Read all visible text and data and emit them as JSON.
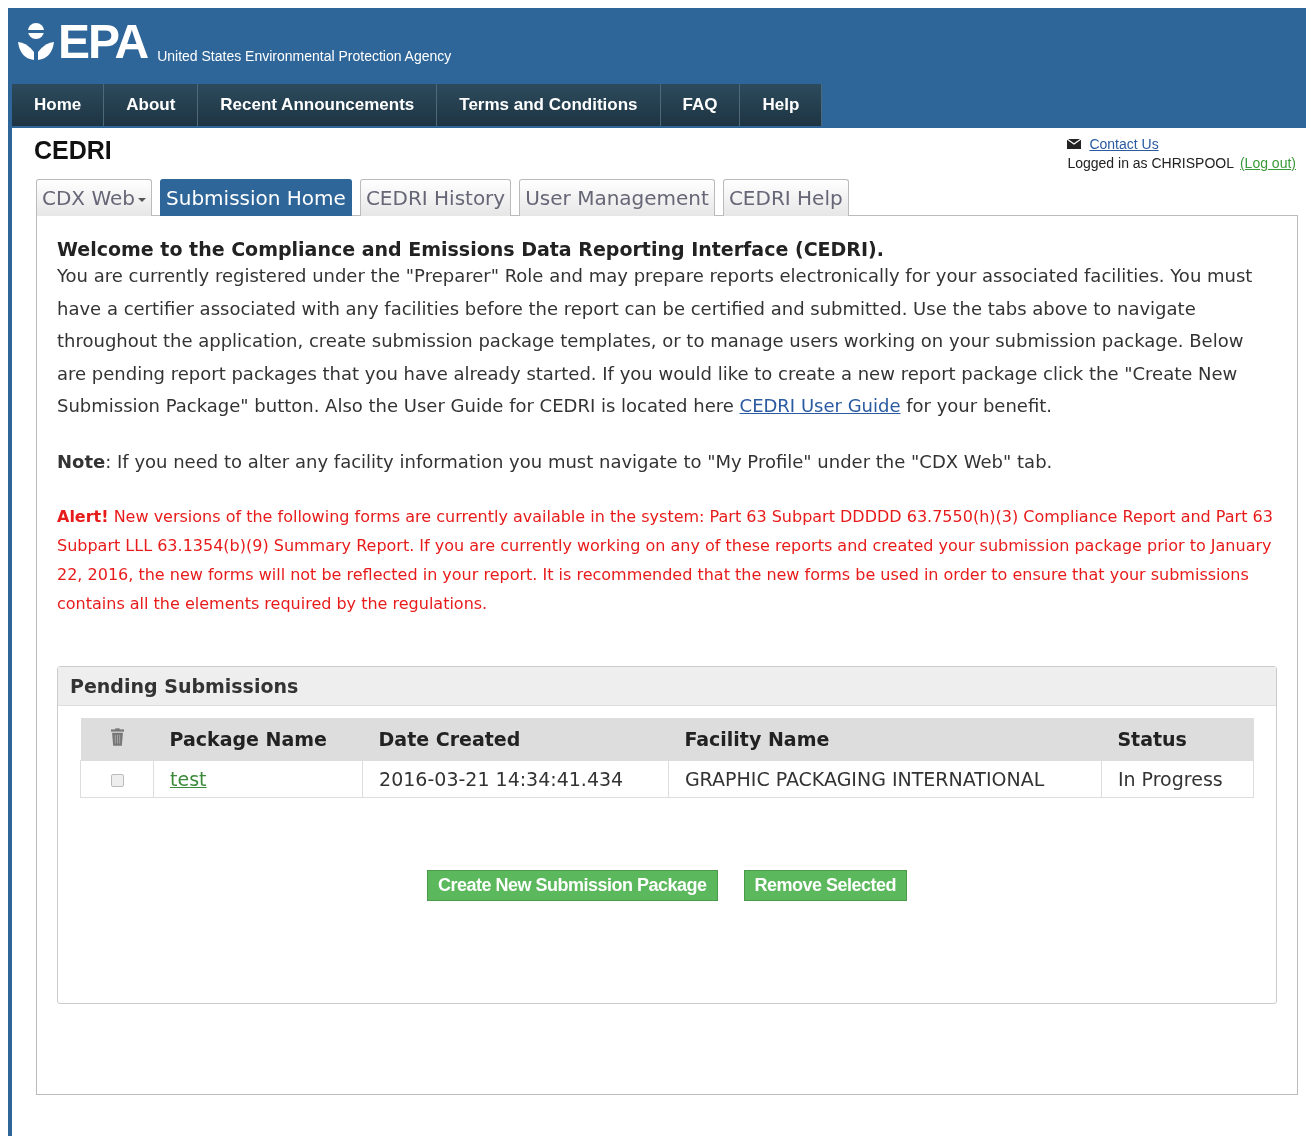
{
  "header": {
    "logo_text": "EPA",
    "agency": "United States Environmental Protection Agency"
  },
  "nav": [
    {
      "label": "Home"
    },
    {
      "label": "About"
    },
    {
      "label": "Recent Announcements"
    },
    {
      "label": "Terms and Conditions"
    },
    {
      "label": "FAQ"
    },
    {
      "label": "Help"
    }
  ],
  "title": "CEDRI",
  "account": {
    "contact_link": "Contact Us",
    "logged_in": "Logged in as CHRISPOOL",
    "logout_link": "(Log out)"
  },
  "tabs": [
    {
      "label": "CDX Web",
      "selected": false,
      "has_menu": true
    },
    {
      "label": "Submission Home",
      "selected": true,
      "has_menu": false
    },
    {
      "label": "CEDRI History",
      "selected": false,
      "has_menu": false
    },
    {
      "label": "User Management",
      "selected": false,
      "has_menu": false
    },
    {
      "label": "CEDRI Help",
      "selected": false,
      "has_menu": false
    }
  ],
  "welcome_heading": "Welcome to the Compliance and Emissions Data Reporting Interface (CEDRI).",
  "intro": {
    "text": "You are currently registered under the \"Preparer\" Role and may prepare reports electronically for your associated facilities. You must have a certifier associated with any facilities before the report can be certified and submitted. Use the tabs above to navigate throughout the application, create submission package templates, or to manage users working on your submission package. Below are pending report packages that you have already started. If you would like to create a new report package click the \"Create New Submission Package\" button. Also the User Guide for CEDRI is located here",
    "link": "CEDRI User Guide",
    "after": "for your benefit."
  },
  "note": "**Note**: If you need to alter any facility information you must navigate to \"My Profile\" under the \"CDX Web\" tab.",
  "alert": "**Alert!** New versions of the following forms are currently available in the system: Part 63 Subpart DDDDD 63.7550(h)(3) Compliance Report and Part 63 Subpart LLL 63.1354(b)(9) Summary Report. If you are currently working on any of these reports and created your submission package prior to January 22, 2016, the new forms will not be reflected in your report. It is recommended that the new forms be used in order to ensure that your submissions contains all the elements required by the regulations.",
  "pending": {
    "title": "Pending Submissions",
    "columns": [
      "Package Name",
      "Date Created",
      "Facility Name",
      "Status"
    ],
    "rows": [
      {
        "checked": false,
        "package": "test",
        "date": "2016-03-21 14:34:41.434",
        "facility": "GRAPHIC PACKAGING INTERNATIONAL",
        "status": "In Progress"
      }
    ],
    "buttons": [
      "Create New Submission Package",
      "Remove Selected"
    ]
  }
}
